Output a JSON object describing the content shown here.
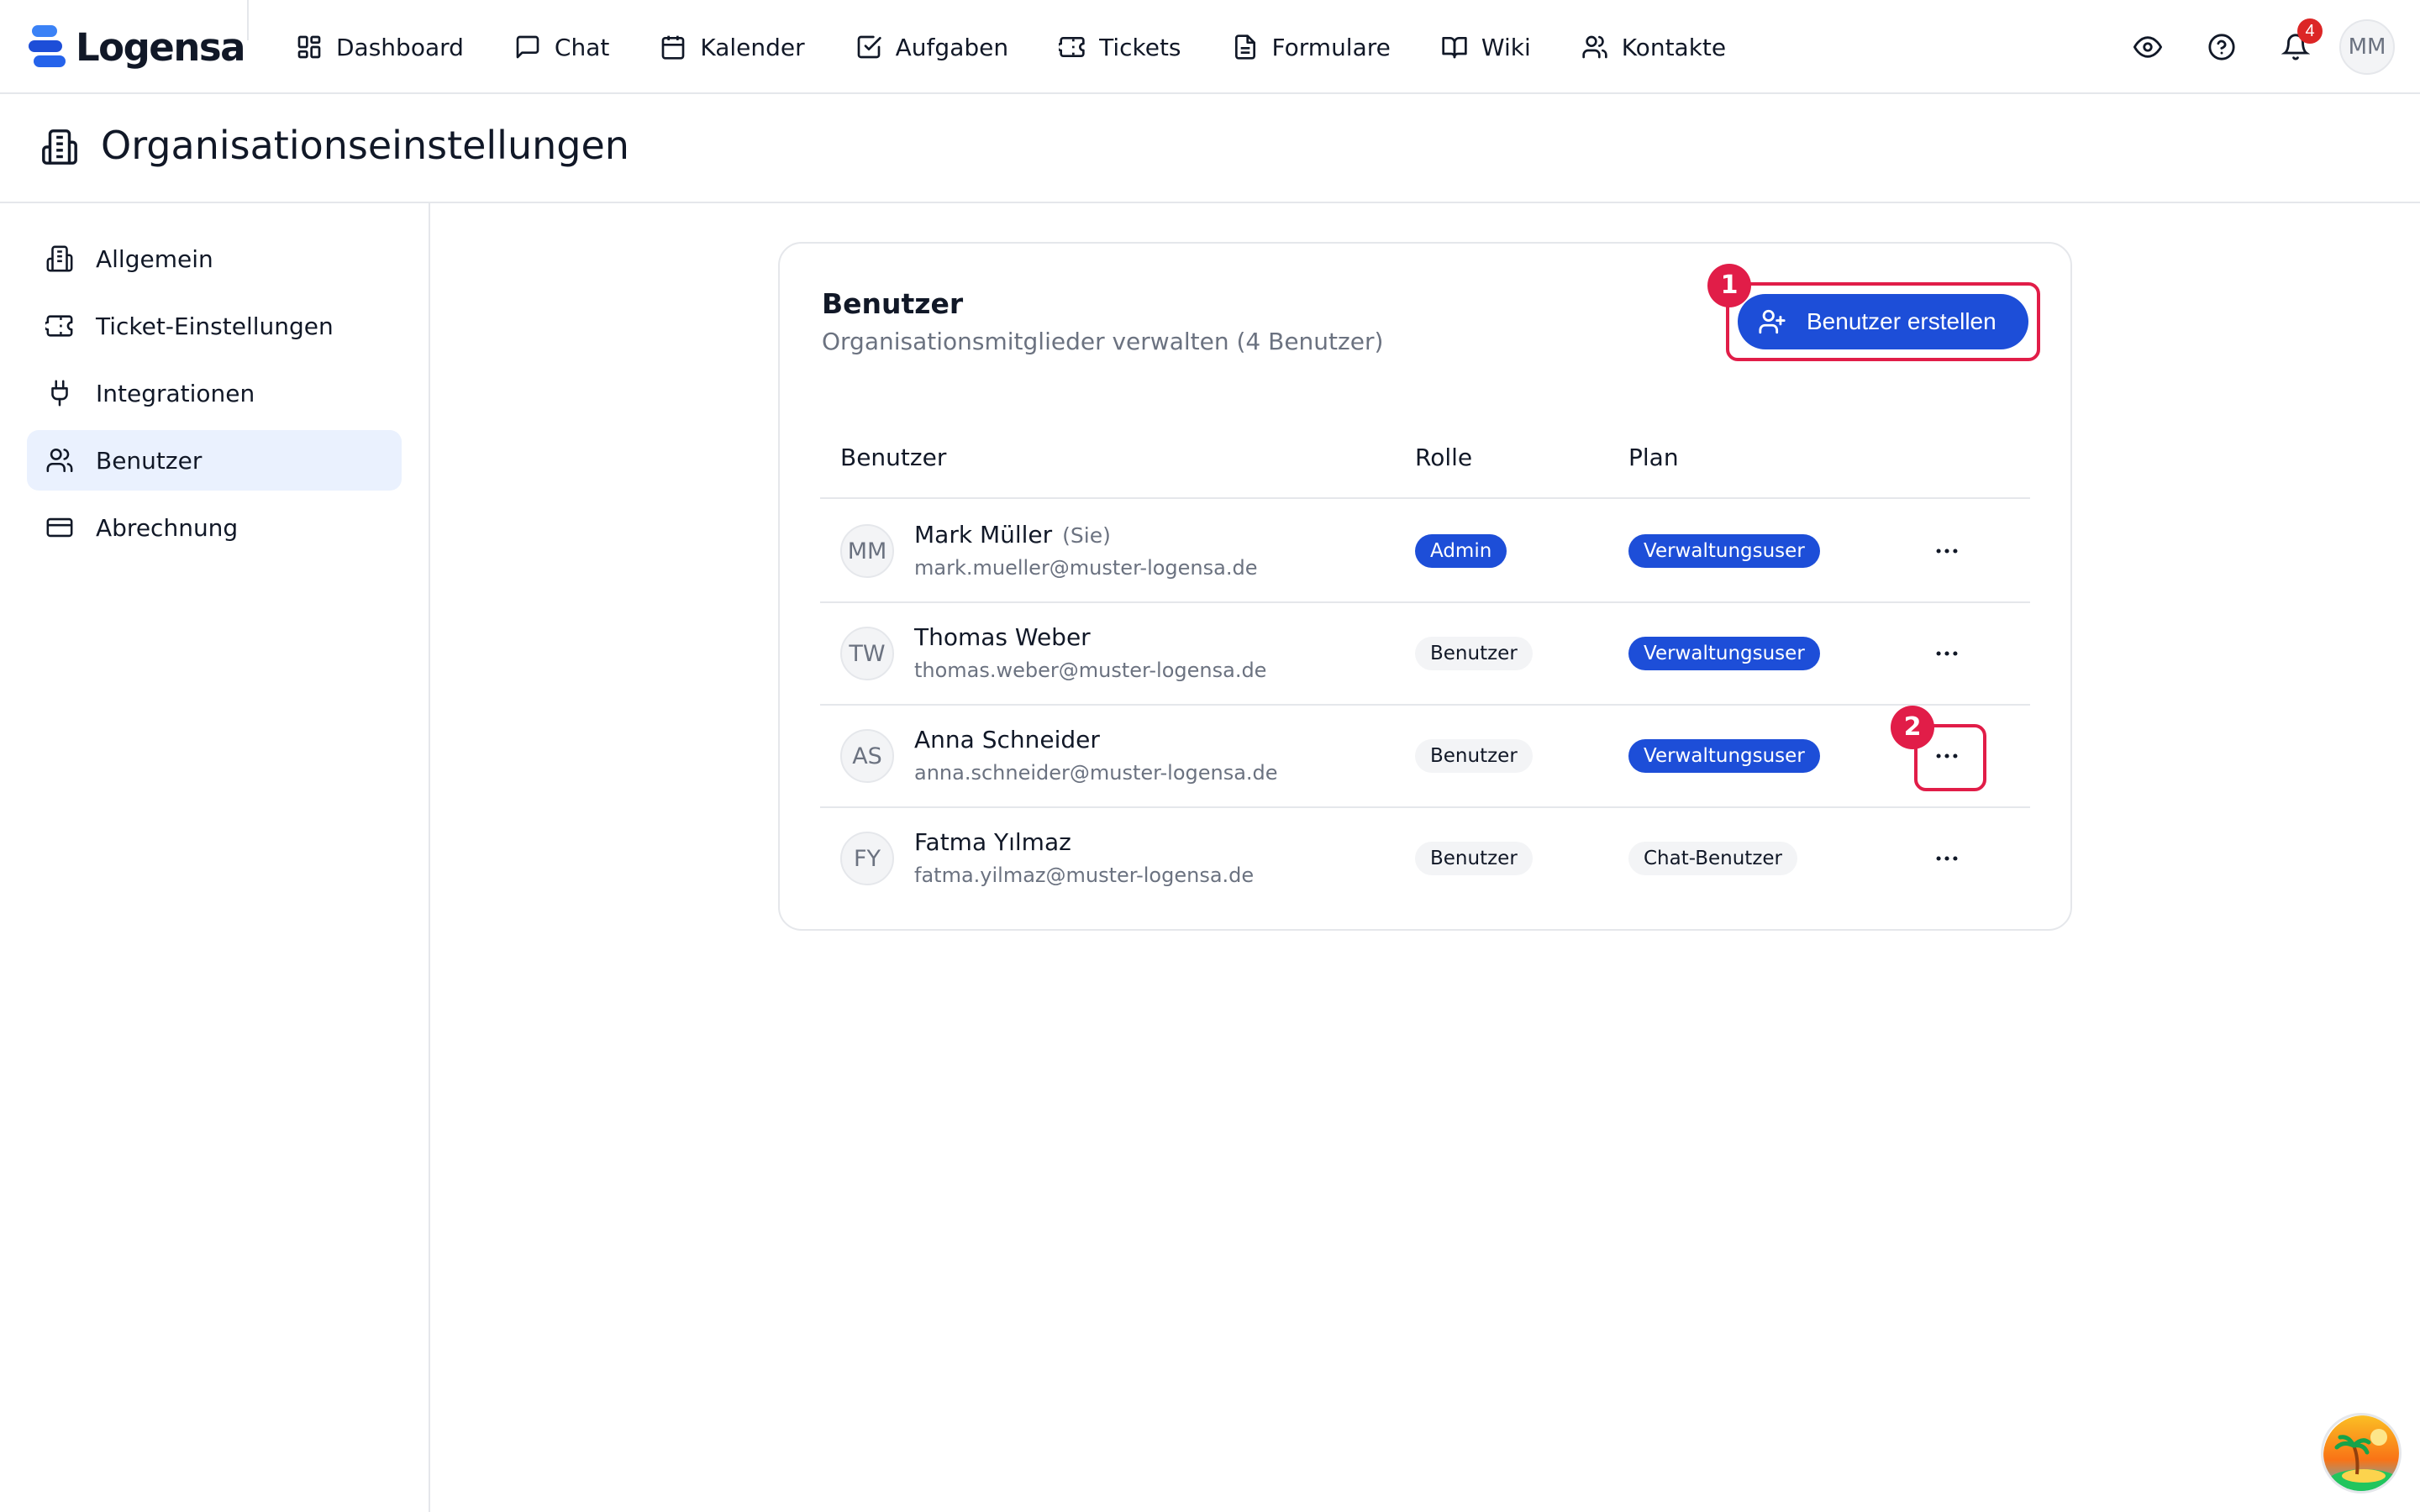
{
  "brand": {
    "name": "Logensa"
  },
  "nav": [
    {
      "label": "Dashboard",
      "icon": "dashboard-icon"
    },
    {
      "label": "Chat",
      "icon": "chat-icon"
    },
    {
      "label": "Kalender",
      "icon": "calendar-icon"
    },
    {
      "label": "Aufgaben",
      "icon": "task-icon"
    },
    {
      "label": "Tickets",
      "icon": "ticket-icon"
    },
    {
      "label": "Formulare",
      "icon": "form-icon"
    },
    {
      "label": "Wiki",
      "icon": "book-icon"
    },
    {
      "label": "Kontakte",
      "icon": "contacts-icon"
    }
  ],
  "top_actions": {
    "notification_count": "4",
    "user_initials": "MM"
  },
  "page": {
    "title": "Organisationseinstellungen"
  },
  "sidebar": {
    "items": [
      {
        "label": "Allgemein",
        "icon": "building-icon"
      },
      {
        "label": "Ticket-Einstellungen",
        "icon": "ticket-icon"
      },
      {
        "label": "Integrationen",
        "icon": "plug-icon"
      },
      {
        "label": "Benutzer",
        "icon": "users-icon",
        "active": true
      },
      {
        "label": "Abrechnung",
        "icon": "credit-card-icon"
      }
    ]
  },
  "users_card": {
    "title": "Benutzer",
    "subtitle": "Organisationsmitglieder verwalten (4 Benutzer)",
    "create_button": "Benutzer erstellen",
    "marker_1": "1",
    "marker_2": "2",
    "columns": {
      "user": "Benutzer",
      "role": "Rolle",
      "plan": "Plan"
    },
    "rows": [
      {
        "initials": "MM",
        "name": "Mark Müller",
        "you": "(Sie)",
        "email": "mark.mueller@muster-logensa.de",
        "role": "Admin",
        "plan": "Verwaltungsuser"
      },
      {
        "initials": "TW",
        "name": "Thomas Weber",
        "you": "",
        "email": "thomas.weber@muster-logensa.de",
        "role": "Benutzer",
        "plan": "Verwaltungsuser"
      },
      {
        "initials": "AS",
        "name": "Anna Schneider",
        "you": "",
        "email": "anna.schneider@muster-logensa.de",
        "role": "Benutzer",
        "plan": "Verwaltungsuser"
      },
      {
        "initials": "FY",
        "name": "Fatma Yılmaz",
        "you": "",
        "email": "fatma.yilmaz@muster-logensa.de",
        "role": "Benutzer",
        "plan": "Chat-Benutzer"
      }
    ]
  },
  "colors": {
    "primary": "#1d4ed8",
    "highlight": "#e11d48",
    "active_bg": "#eaf1fe",
    "border": "#e5e7eb"
  }
}
